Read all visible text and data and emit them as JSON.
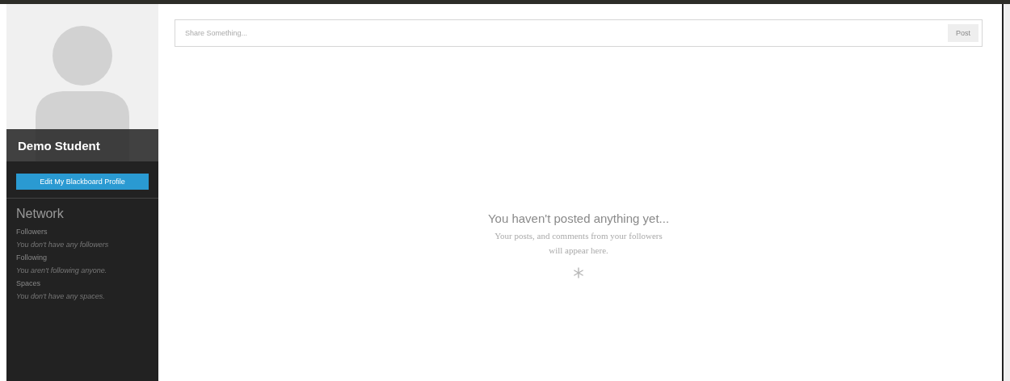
{
  "profile": {
    "name": "Demo Student",
    "edit_button": "Edit My Blackboard Profile"
  },
  "network": {
    "title": "Network",
    "items": [
      {
        "kind": "heading",
        "text": "Followers"
      },
      {
        "kind": "note",
        "text": "You don't have any followers"
      },
      {
        "kind": "heading",
        "text": "Following"
      },
      {
        "kind": "note",
        "text": "You aren't following anyone."
      },
      {
        "kind": "heading",
        "text": "Spaces"
      },
      {
        "kind": "note",
        "text": "You don't have any spaces."
      }
    ]
  },
  "composer": {
    "placeholder": "Share Something...",
    "button": "Post"
  },
  "empty_state": {
    "title": "You haven't posted anything yet...",
    "message": "Your posts, and comments from your followers will appear here."
  }
}
